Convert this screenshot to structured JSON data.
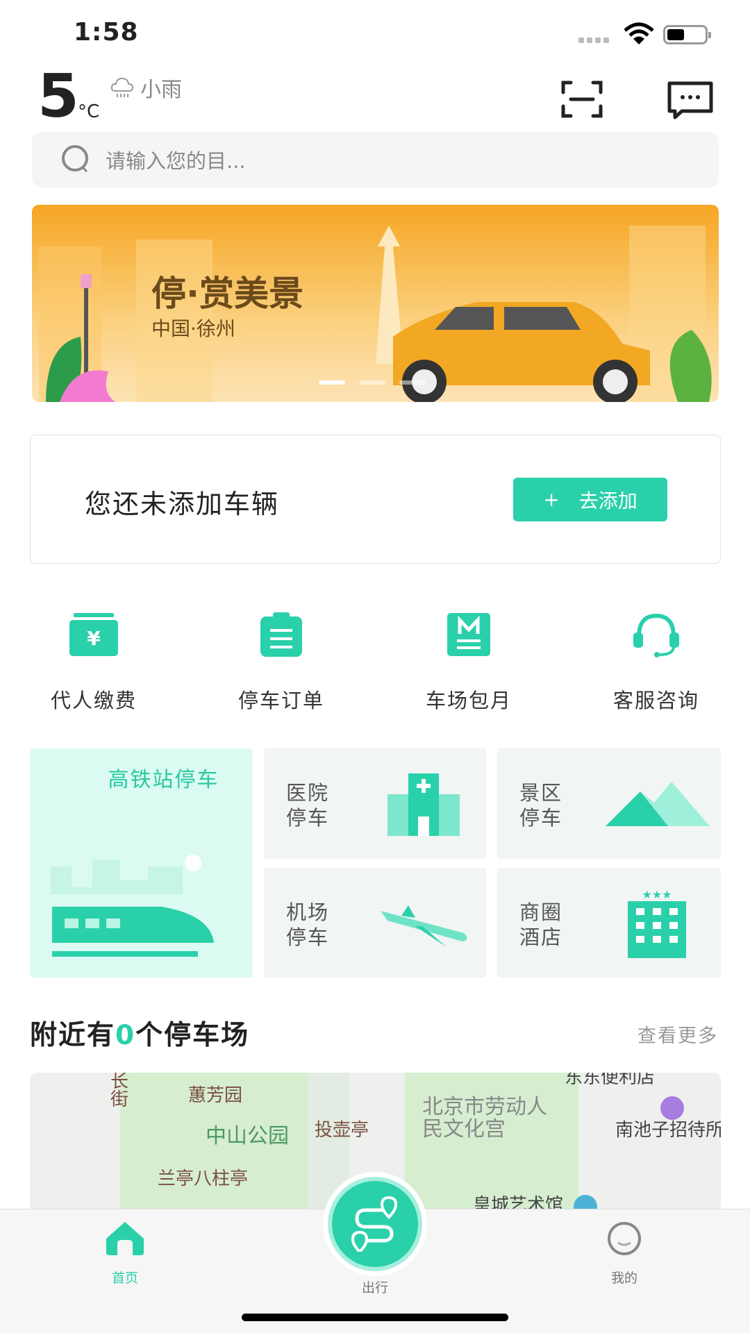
{
  "status": {
    "time": "1:58"
  },
  "weather": {
    "temp": "5",
    "unit": "°C",
    "desc": "小雨"
  },
  "search": {
    "placeholder": "请输入您的目..."
  },
  "banner": {
    "title": "停·赏美景",
    "subtitle": "中国·徐州",
    "slide_count": 3,
    "active_slide": 1
  },
  "vehicle": {
    "message": "您还未添加车辆",
    "add_label": "去添加",
    "add_icon": "+"
  },
  "quick": [
    {
      "label": "代人缴费",
      "icon": "yen-wallet-icon"
    },
    {
      "label": "停车订单",
      "icon": "clipboard-icon"
    },
    {
      "label": "车场包月",
      "icon": "monthly-m-icon"
    },
    {
      "label": "客服咨询",
      "icon": "headset-icon"
    }
  ],
  "tiles": {
    "rail": "高铁站停车",
    "hospital": "医院停车",
    "scenic": "景区停车",
    "airport": "机场停车",
    "hotel": "商圈酒店"
  },
  "nearby": {
    "prefix": "附近有",
    "count": "0",
    "suffix": "个停车场",
    "more": "查看更多"
  },
  "map_labels": [
    "长街",
    "蕙芳园",
    "中山公园",
    "投壶亭",
    "北京市劳动人民文化宫",
    "南池子招待所",
    "兰亭八柱亭",
    "皇城艺术馆",
    "东东便利店"
  ],
  "tabs": [
    {
      "label": "首页",
      "active": true
    },
    {
      "label": "出行"
    },
    {
      "label": "我的"
    }
  ],
  "colors": {
    "accent": "#2ad0aa"
  }
}
